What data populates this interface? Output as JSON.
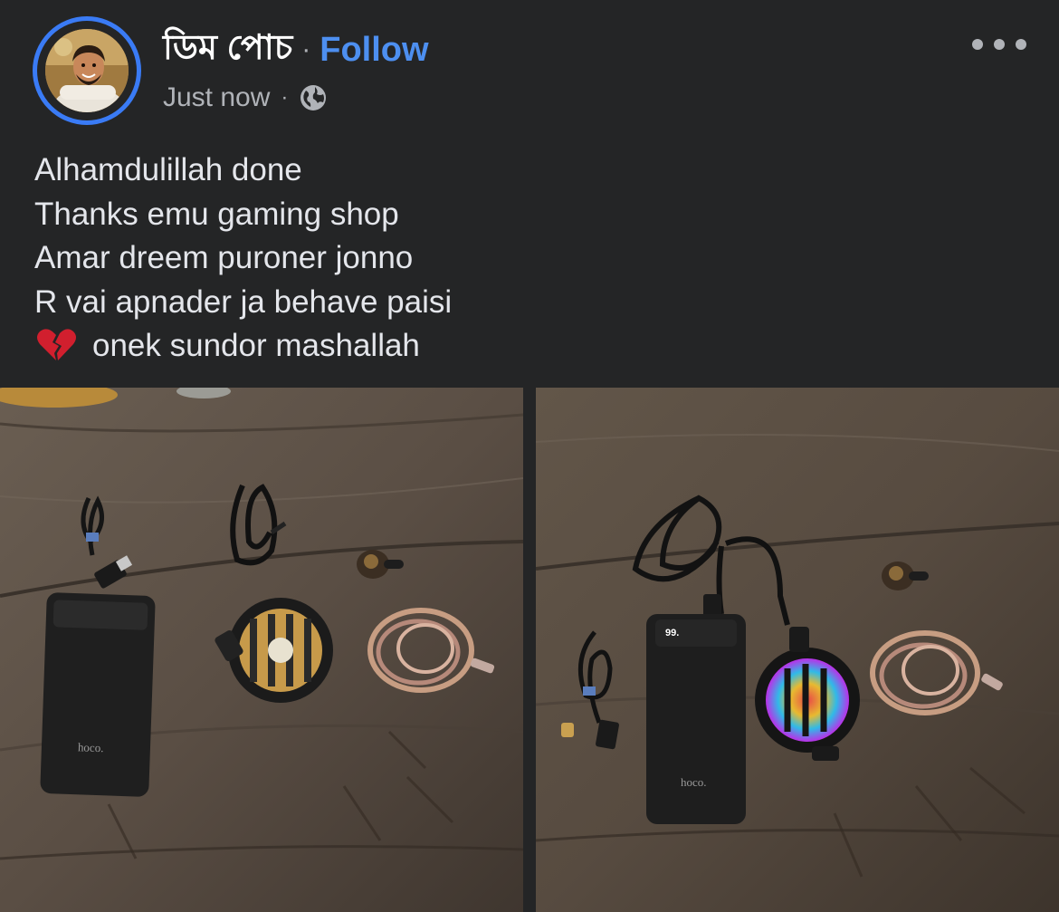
{
  "post": {
    "author_name": "ডিম পোচ",
    "separator": "·",
    "follow_label": "Follow",
    "timestamp": "Just now",
    "audience_icon": "globe-icon",
    "more_icon": "more-options-icon",
    "caption_lines": [
      "Alhamdulillah done",
      "Thanks emu gaming shop",
      "Amar dreem puroner jonno",
      "R vai apnader ja behave paisi"
    ],
    "caption_last_line_emoji": "broken-heart-icon",
    "caption_last_line_text": "onek sundor mashallah"
  },
  "photos": {
    "photo1": {
      "powerbank_brand": "hoco."
    },
    "photo2": {
      "powerbank_brand": "hoco.",
      "powerbank_display": "99."
    }
  },
  "colors": {
    "background": "#242526",
    "follow": "#4d8ff0",
    "avatar_ring": "#3a7bf5",
    "secondary_text": "#b0b3b8"
  }
}
